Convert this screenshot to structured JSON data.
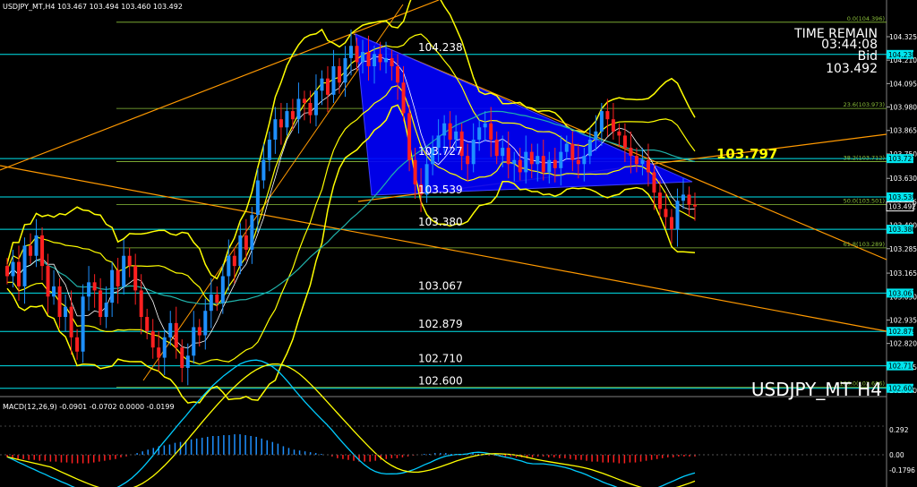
{
  "header": {
    "symbol_info": "USDJPY_MT,H4  103.467 103.494 103.460 103.492",
    "macd_info": "MACD(12,26,9) -0.0901 -0.0702 0.0000 -0.0199"
  },
  "overlay": {
    "time_remain_label": "TIME REMAIN",
    "time_remain_value": "03:44:08",
    "bid_label": "Bid",
    "bid_value": "103.492",
    "watermark": "USDJPY_MT H4",
    "highlight_price": "103.797"
  },
  "colors": {
    "background": "#000000",
    "bull": "#1e90ff",
    "bear": "#ff2020",
    "bands": "#ffff00",
    "levels": "#00e5ee",
    "trend": "#ff9900",
    "triangle": "#0000ff",
    "macd_line": "#00ccff",
    "signal_line": "#ffff00"
  },
  "chart_data": [
    {
      "type": "candlestick",
      "title": "USDJPY_MT H4",
      "ylim": [
        102.5,
        104.5
      ],
      "price_ticks": [
        "104.325",
        "104.210",
        "104.095",
        "103.980",
        "103.865",
        "103.750",
        "103.630",
        "103.515",
        "103.400",
        "103.285",
        "103.165",
        "103.050",
        "102.935",
        "102.820",
        "102.705",
        "102.590"
      ],
      "horizontal_levels": [
        {
          "label": "104.238",
          "value": 104.238
        },
        {
          "label": "103.727",
          "value": 103.727
        },
        {
          "label": "103.539",
          "value": 103.539
        },
        {
          "label": "103.380",
          "value": 103.38
        },
        {
          "label": "103.067",
          "value": 103.067
        },
        {
          "label": "102.879",
          "value": 102.879
        },
        {
          "label": "102.710",
          "value": 102.71
        },
        {
          "label": "102.600",
          "value": 102.6
        }
      ],
      "axis_tags": [
        "104.238",
        "103.727",
        "103.539",
        "103.492",
        "103.380",
        "103.067",
        "102.879",
        "102.710",
        "102.600"
      ],
      "fibonacci": [
        {
          "label": "0.0(104.396)",
          "value": 104.396
        },
        {
          "label": "23.6(103.973)",
          "value": 103.973
        },
        {
          "label": "38.2(103.712)",
          "value": 103.712
        },
        {
          "label": "50.0(103.501)",
          "value": 103.501
        },
        {
          "label": "61.8(103.289)",
          "value": 103.289
        },
        {
          "label": "100.0(102.606)",
          "value": 102.606
        }
      ],
      "current_price": 103.492,
      "closes": [
        103.15,
        103.22,
        103.1,
        103.3,
        103.25,
        103.35,
        103.2,
        103.05,
        103.1,
        102.95,
        103.0,
        102.85,
        102.78,
        103.05,
        103.12,
        103.08,
        102.95,
        103.02,
        103.18,
        103.1,
        103.25,
        103.2,
        103.08,
        102.95,
        102.88,
        102.8,
        102.75,
        102.85,
        102.92,
        102.8,
        102.7,
        102.76,
        102.9,
        102.86,
        102.98,
        103.06,
        103.02,
        103.15,
        103.25,
        103.2,
        103.35,
        103.28,
        103.45,
        103.62,
        103.72,
        103.82,
        103.92,
        103.88,
        103.96,
        103.92,
        104.02,
        104.0,
        103.94,
        104.06,
        104.12,
        104.04,
        104.18,
        104.1,
        104.22,
        104.28,
        104.2,
        104.25,
        104.18,
        104.24,
        104.2,
        104.22,
        104.18,
        104.1,
        103.95,
        103.72,
        103.6,
        103.55,
        103.7,
        103.78,
        103.84,
        103.9,
        103.82,
        103.86,
        103.74,
        103.7,
        103.82,
        103.88,
        103.9,
        103.82,
        103.74,
        103.78,
        103.7,
        103.72,
        103.66,
        103.76,
        103.7,
        103.74,
        103.66,
        103.72,
        103.68,
        103.76,
        103.8,
        103.72,
        103.7,
        103.74,
        103.82,
        103.86,
        103.96,
        103.92,
        103.86,
        103.84,
        103.78,
        103.74,
        103.7,
        103.72,
        103.66,
        103.56,
        103.48,
        103.44,
        103.38,
        103.52,
        103.55,
        103.5,
        103.492
      ]
    },
    {
      "type": "bar",
      "title": "MACD(12,26,9)",
      "ylim": [
        -0.1796,
        0.292
      ],
      "ticks": [
        "0.292",
        "0.00",
        "-0.1796"
      ],
      "macd": -0.0901,
      "signal": -0.0702,
      "histogram": [
        -0.03,
        -0.04,
        -0.05,
        -0.05,
        -0.06,
        -0.06,
        -0.07,
        -0.07,
        -0.08,
        -0.08,
        -0.09,
        -0.09,
        -0.1,
        -0.1,
        -0.1,
        -0.1,
        -0.09,
        -0.08,
        -0.07,
        -0.06,
        -0.05,
        -0.03,
        -0.02,
        0.0,
        0.02,
        0.04,
        0.06,
        0.08,
        0.1,
        0.11,
        0.12,
        0.14,
        0.15,
        0.16,
        0.18,
        0.19,
        0.2,
        0.21,
        0.22,
        0.22,
        0.23,
        0.23,
        0.24,
        0.24,
        0.23,
        0.22,
        0.21,
        0.19,
        0.17,
        0.15,
        0.13,
        0.1,
        0.08,
        0.06,
        0.05,
        0.04,
        0.03,
        0.02,
        0.01,
        0.0,
        -0.02,
        -0.04,
        -0.05,
        -0.06,
        -0.07,
        -0.08,
        -0.08,
        -0.08,
        -0.07,
        -0.06,
        -0.05,
        -0.04,
        -0.04,
        -0.03,
        -0.02,
        -0.01,
        0.0,
        0.01,
        0.01,
        0.02,
        0.02,
        0.02,
        0.01,
        0.01,
        0.0,
        0.01,
        0.02,
        0.01,
        0.0,
        -0.01,
        -0.01,
        -0.02,
        -0.02,
        -0.02,
        -0.03,
        -0.03,
        -0.04,
        -0.03,
        -0.02,
        -0.02,
        -0.03,
        -0.03,
        -0.04,
        -0.04,
        -0.05,
        -0.06,
        -0.06,
        -0.07,
        -0.08,
        -0.08,
        -0.09,
        -0.09,
        -0.09,
        -0.1,
        -0.1,
        -0.09,
        -0.09,
        -0.08,
        -0.07,
        -0.06,
        -0.05,
        -0.04,
        -0.03,
        -0.03,
        -0.02,
        -0.02,
        -0.02,
        -0.02
      ]
    }
  ]
}
